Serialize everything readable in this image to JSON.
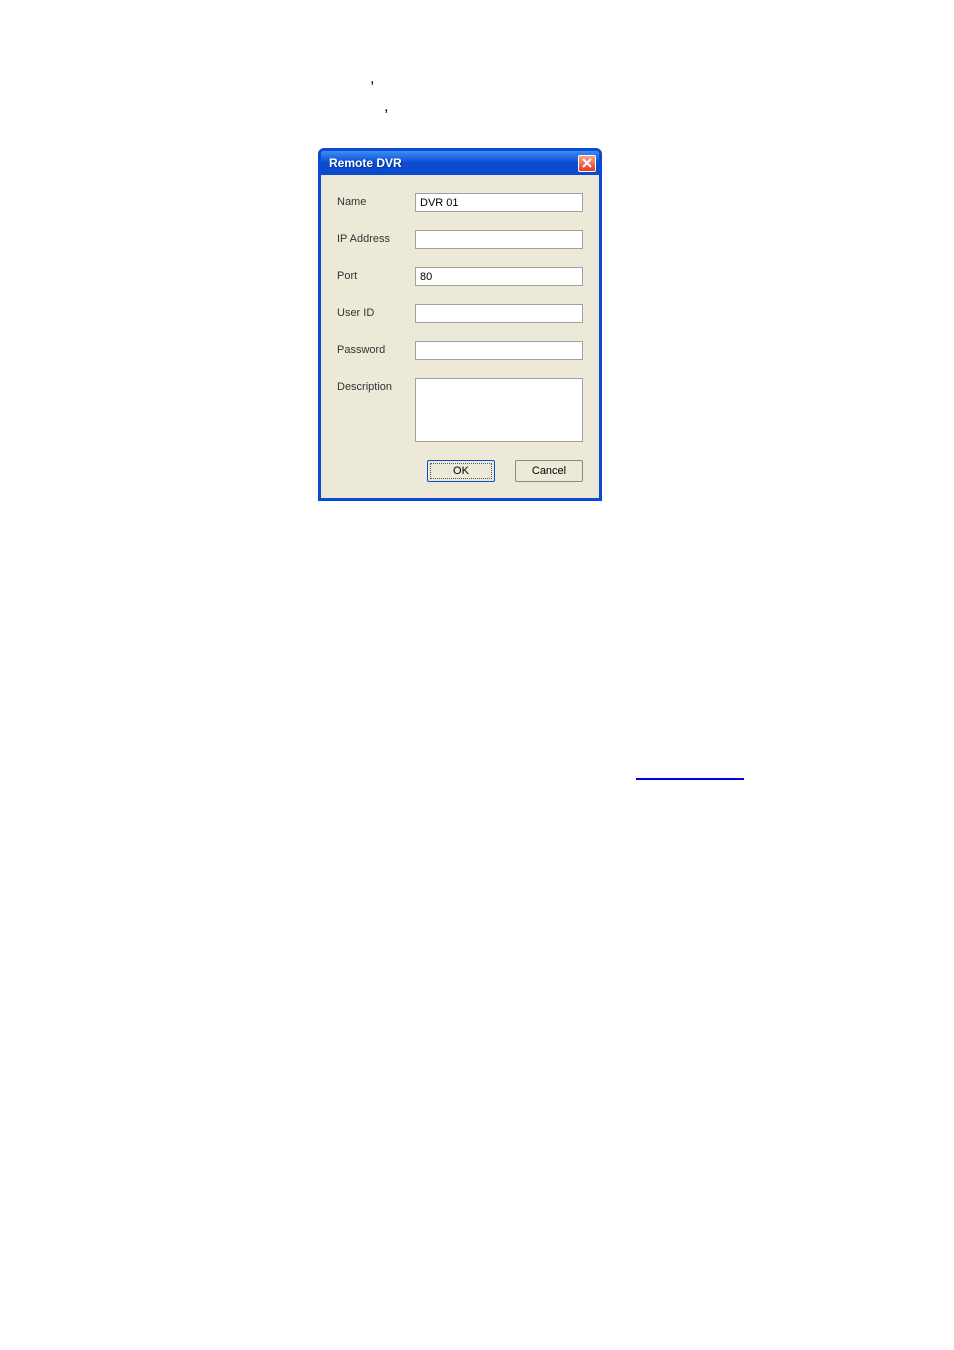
{
  "dialog": {
    "title": "Remote DVR",
    "fields": {
      "name_label": "Name",
      "name_value": "DVR 01",
      "ip_label": "IP Address",
      "ip_value": "",
      "port_label": "Port",
      "port_value": "80",
      "userid_label": "User ID",
      "userid_value": "",
      "password_label": "Password",
      "password_value": "",
      "description_label": "Description",
      "description_value": ""
    },
    "buttons": {
      "ok": "OK",
      "cancel": "Cancel"
    }
  },
  "ticks": {
    "t1": ",",
    "t2": ","
  }
}
